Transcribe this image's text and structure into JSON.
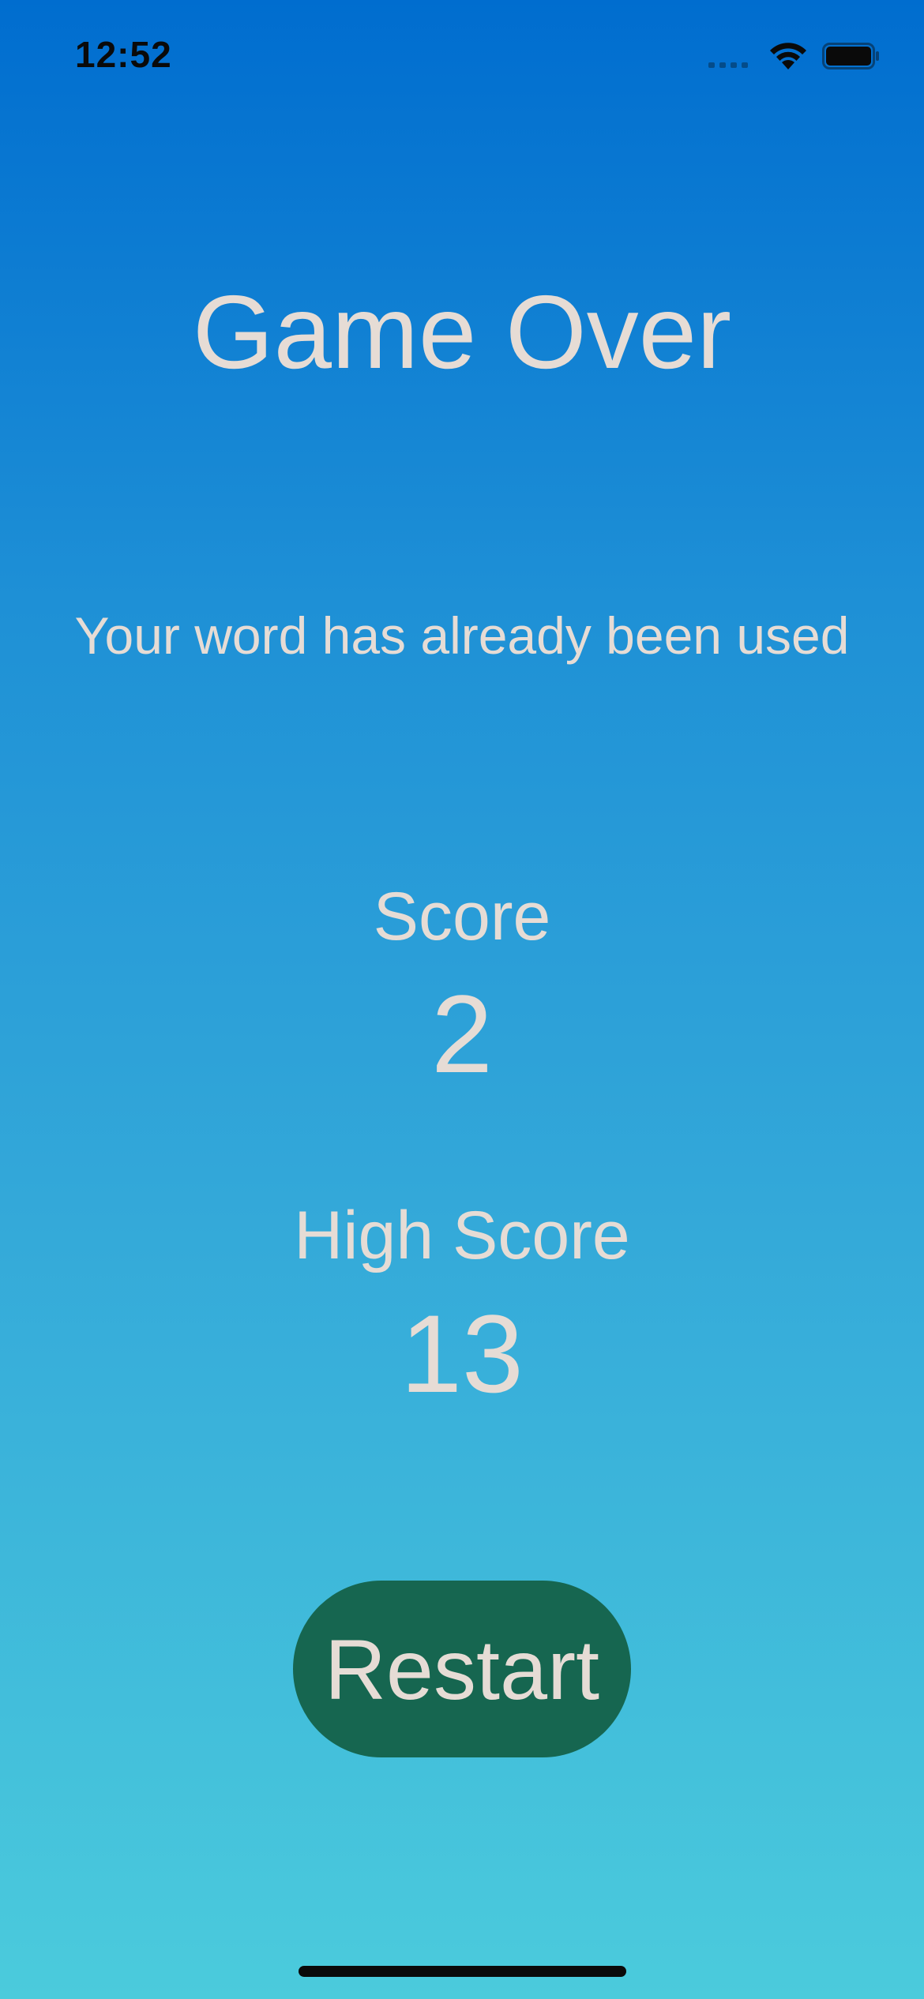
{
  "status_bar": {
    "time": "12:52",
    "icons": [
      "cellular-signal-icon",
      "wifi-icon",
      "battery-icon"
    ]
  },
  "game_over": {
    "title": "Game Over",
    "message": "Your word has already been used",
    "score_label": "Score",
    "score_value": "2",
    "high_score_label": "High Score",
    "high_score_value": "13",
    "restart_label": "Restart"
  },
  "colors": {
    "background_top": "#006dcf",
    "background_bottom": "#4bcbdc",
    "text": "#e6dcd5",
    "button_background": "#166650"
  }
}
